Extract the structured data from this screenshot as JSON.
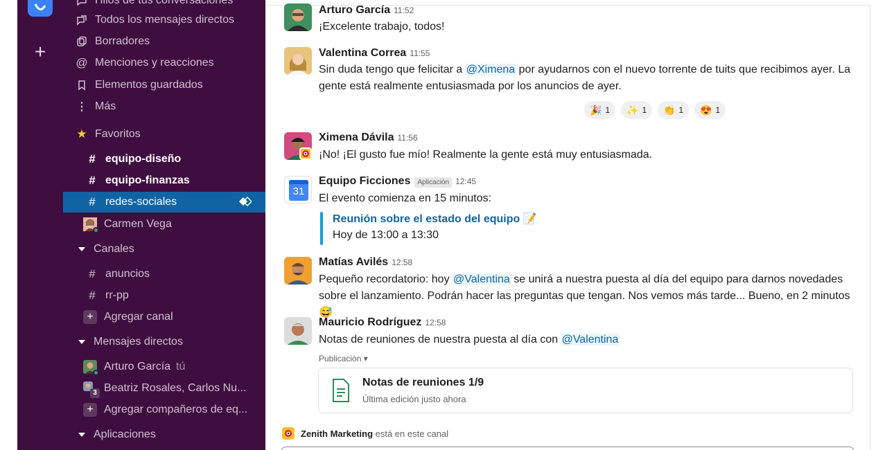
{
  "sidebar": {
    "nav": [
      {
        "label": "Hilos de tus conversaciones",
        "icon": "thread-icon"
      },
      {
        "label": "Todos los mensajes directos",
        "icon": "dm-icon"
      },
      {
        "label": "Borradores",
        "icon": "drafts-icon"
      },
      {
        "label": "Menciones y reacciones",
        "icon": "at-icon"
      },
      {
        "label": "Elementos guardados",
        "icon": "bookmark-icon"
      },
      {
        "label": "Más",
        "icon": "more-icon"
      }
    ],
    "favorites_header": "Favoritos",
    "favorites": [
      {
        "label": "equipo-diseño"
      },
      {
        "label": "equipo-finanzas"
      },
      {
        "label": "redes-sociales"
      }
    ],
    "favorite_dm": "Carmen Vega",
    "channels_header": "Canales",
    "channels": [
      {
        "label": "anuncios"
      },
      {
        "label": "rr-pp"
      }
    ],
    "add_channel": "Agregar canal",
    "dms_header": "Mensajes directos",
    "dms": [
      {
        "label": "Arturo García",
        "tag": "tú"
      },
      {
        "label": "Beatriz Rosales, Carlos Nu...",
        "count": "3"
      }
    ],
    "add_teammates": "Agregar compañeros de eq...",
    "apps_header": "Aplicaciones"
  },
  "messages": [
    {
      "sender": "Arturo García",
      "time": "11:52",
      "text": "¡Excelente trabajo, todos!"
    },
    {
      "sender": "Valentina Correa",
      "time": "11:55",
      "pre": "Sin duda tengo que felicitar a ",
      "mention": "@Ximena",
      "post": " por ayudarnos con el nuevo torrente de tuits que recibimos ayer. La gente está realmente entusiasmada por los anuncios de ayer.",
      "reactions": [
        {
          "emoji": "🎉",
          "count": "1"
        },
        {
          "emoji": "✨",
          "count": "1"
        },
        {
          "emoji": "👏",
          "count": "1"
        },
        {
          "emoji": "😍",
          "count": "1"
        }
      ]
    },
    {
      "sender": "Ximena Dávila",
      "time": "11:56",
      "text": "¡No! ¡El gusto fue mío! Realmente la gente está muy entusiasmada."
    },
    {
      "sender": "Equipo Ficciones",
      "badge": "Aplicación",
      "time": "12:45",
      "text": "El evento comienza en 15 minutos:",
      "calendar_day": "31",
      "quote_title": "Reunión sobre el estado del equipo 📝",
      "quote_body": "Hoy de 13:00 a 13:30"
    },
    {
      "sender": "Matías Avilés",
      "time": "12:58",
      "pre": "Pequeño recordatorio: hoy ",
      "mention": "@Valentina",
      "post": " se unirá a nuestra puesta al día del equipo para darnos novedades sobre el lanzamiento. Podrán hacer las preguntas que tengan. Nos vemos más tarde... Bueno, en 2 minutos 😅"
    },
    {
      "sender": "Mauricio Rodríguez",
      "time": "12:58",
      "pre": "Notas de reuniones de nuestra puesta al día con ",
      "mention": "@Valentina",
      "post_label": "Publicación ▾",
      "file_title": "Notas de reuniones 1/9",
      "file_sub": "Última edición justo ahora"
    }
  ],
  "channel_note": {
    "app": "Zenith Marketing",
    "text": " está en este canal"
  },
  "colors": {
    "sidebar": "#3f0e40",
    "active": "#1164a3",
    "link": "#1264a3"
  }
}
